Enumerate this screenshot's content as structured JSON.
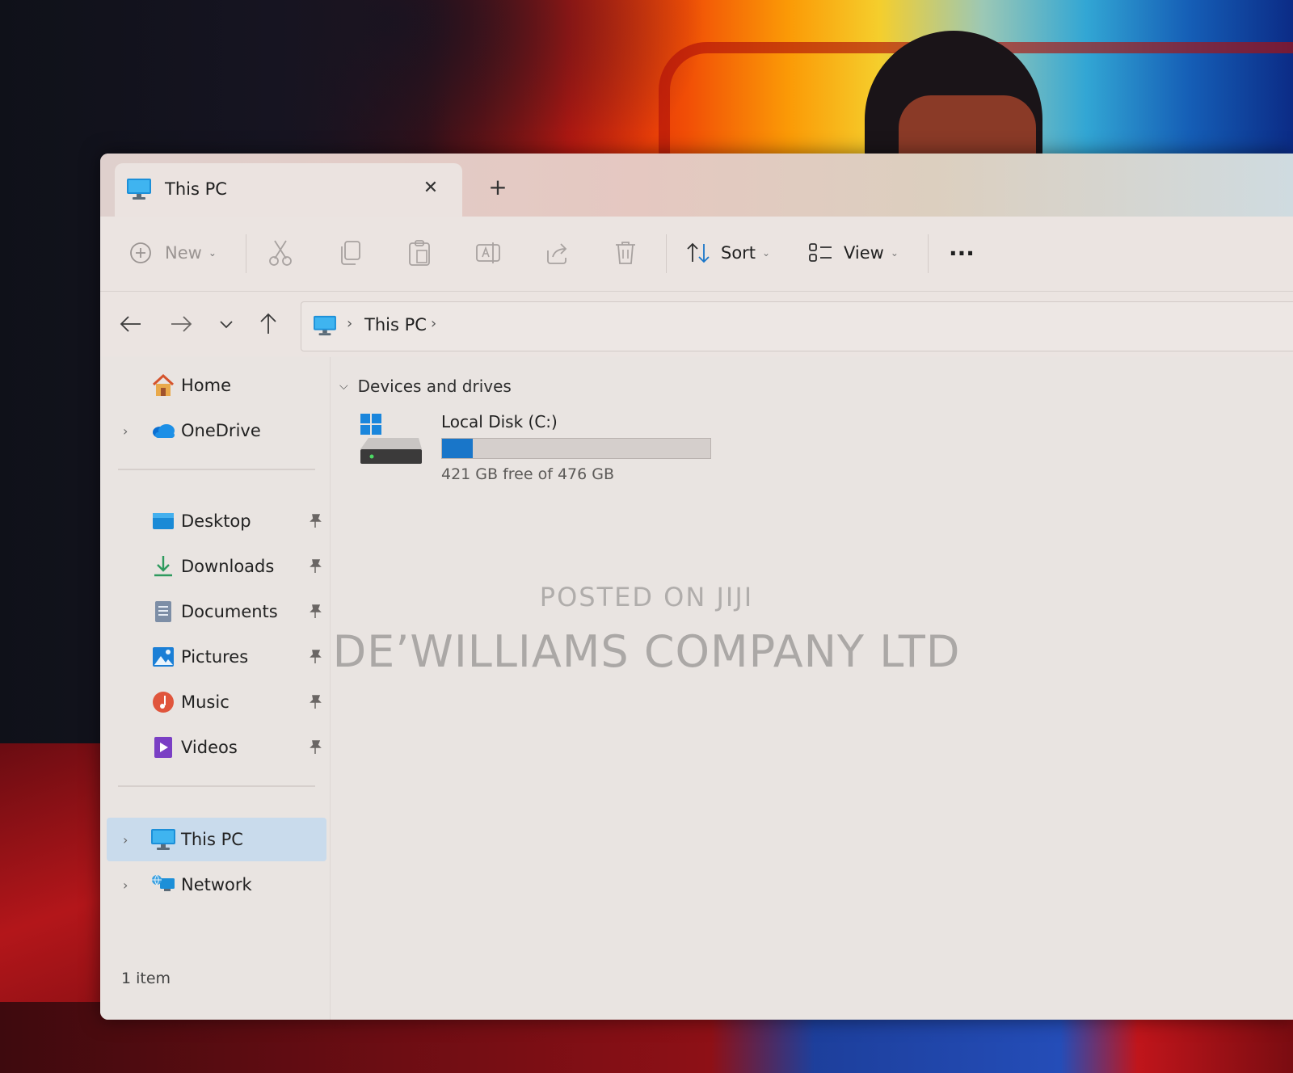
{
  "window": {
    "tab_title": "This PC",
    "close_glyph": "✕",
    "new_tab_glyph": "+"
  },
  "toolbar": {
    "new_label": "New",
    "sort_label": "Sort",
    "view_label": "View",
    "more_glyph": "···"
  },
  "address": {
    "location": "This PC",
    "separator": "›"
  },
  "sidebar": {
    "items": [
      {
        "label": "Home",
        "icon": "home-icon"
      },
      {
        "label": "OneDrive",
        "icon": "onedrive-icon"
      },
      {
        "label": "Desktop",
        "icon": "desktop-folder-icon",
        "pinned": true
      },
      {
        "label": "Downloads",
        "icon": "downloads-icon",
        "pinned": true
      },
      {
        "label": "Documents",
        "icon": "documents-icon",
        "pinned": true
      },
      {
        "label": "Pictures",
        "icon": "pictures-icon",
        "pinned": true
      },
      {
        "label": "Music",
        "icon": "music-icon",
        "pinned": true
      },
      {
        "label": "Videos",
        "icon": "videos-icon",
        "pinned": true
      },
      {
        "label": "This PC",
        "icon": "this-pc-icon",
        "selected": true
      },
      {
        "label": "Network",
        "icon": "network-icon"
      }
    ]
  },
  "content": {
    "group_title": "Devices and drives",
    "drives": [
      {
        "name": "Local Disk (C:)",
        "free_text": "421 GB free of 476 GB",
        "used_fraction": 0.1155
      }
    ]
  },
  "status": {
    "item_count": "1 item"
  },
  "watermark": {
    "line1": "POSTED ON JIJI",
    "line2": "DE’WILLIAMS COMPANY LTD"
  },
  "colors": {
    "accent": "#1976c9",
    "selected_bg": "#c9dbec",
    "window_bg": "#e9e4e1"
  }
}
